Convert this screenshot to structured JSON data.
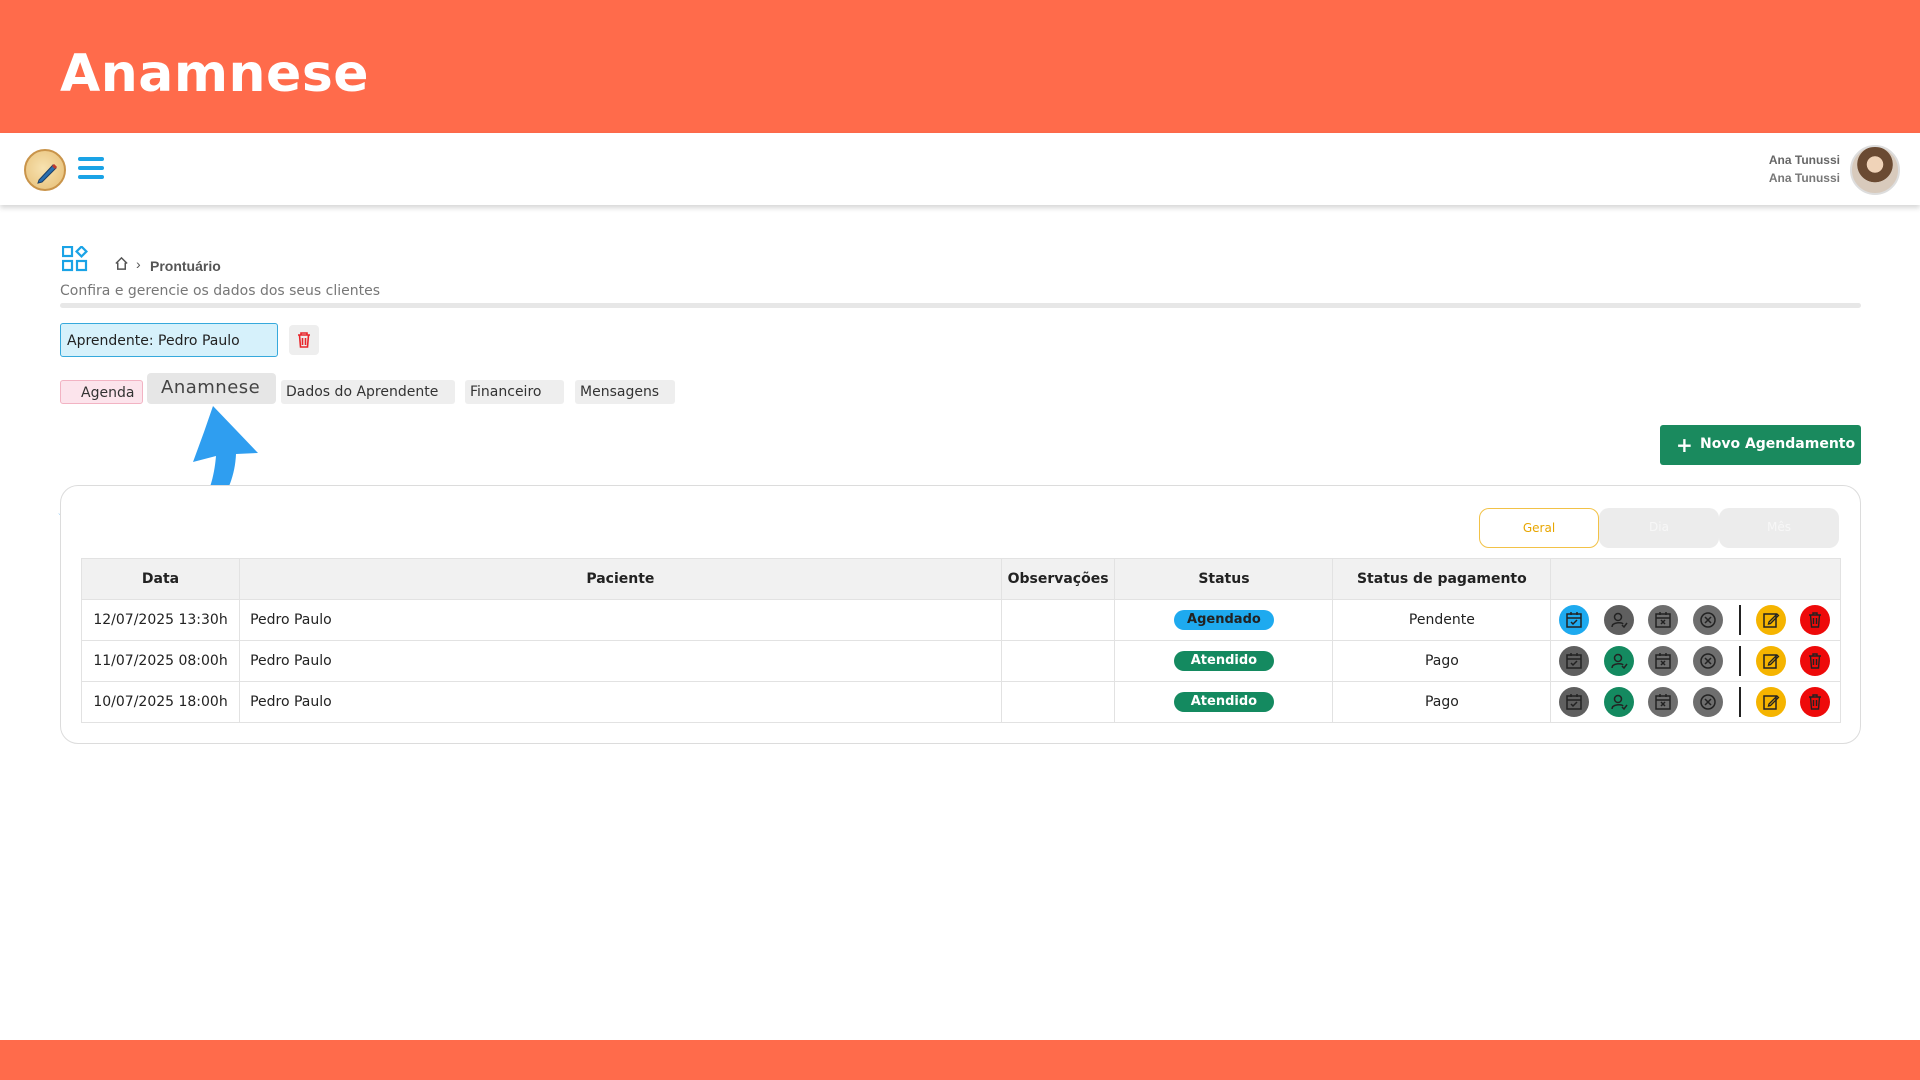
{
  "banner": {
    "title": "Anamnese"
  },
  "topnav": {
    "user_name": "Ana Tunussi",
    "user_sub": "Ana Tunussi"
  },
  "breadcrumb": {
    "current": "Prontuário",
    "subtitle": "Confira e gerencie os dados dos seus clientes"
  },
  "aprendente": {
    "value": "Aprendente: Pedro Paulo"
  },
  "tabs": [
    {
      "label": "Agenda"
    },
    {
      "label": "Anamnese"
    },
    {
      "label": "Dados do Aprendente"
    },
    {
      "label": "Financeiro"
    },
    {
      "label": "Mensagens"
    }
  ],
  "actions": {
    "novo_label": "Novo Agendamento"
  },
  "filters": [
    "Geral",
    "Dia",
    "Mês"
  ],
  "table": {
    "headers": [
      "Data",
      "Paciente",
      "Observações",
      "Status",
      "Status de pagamento"
    ],
    "rows": [
      {
        "data": "12/07/2025 13:30h",
        "paciente": "Pedro Paulo",
        "obs": "",
        "status": "Agendado",
        "pagamento": "Pendente"
      },
      {
        "data": "11/07/2025 08:00h",
        "paciente": "Pedro Paulo",
        "obs": "",
        "status": "Atendido",
        "pagamento": "Pago"
      },
      {
        "data": "10/07/2025 18:00h",
        "paciente": "Pedro Paulo",
        "obs": "",
        "status": "Atendido",
        "pagamento": "Pago"
      }
    ]
  },
  "colors": {
    "banner": "#ff6b4b",
    "accent_blue": "#1aa3e6",
    "success_green": "#1a8a5e",
    "warning_yellow": "#f5b400",
    "danger_red": "#ee0a0a"
  },
  "icons": {
    "logo": "pencil-logo-icon",
    "menu": "hamburger-icon",
    "grid": "grid-icon",
    "home": "home-icon",
    "delete": "trash-icon",
    "arrow": "curved-arrow-icon",
    "row_actions": [
      "calendar-check-icon",
      "user-check-icon",
      "calendar-x-icon",
      "cancel-icon",
      "edit-icon",
      "trash-icon"
    ]
  }
}
